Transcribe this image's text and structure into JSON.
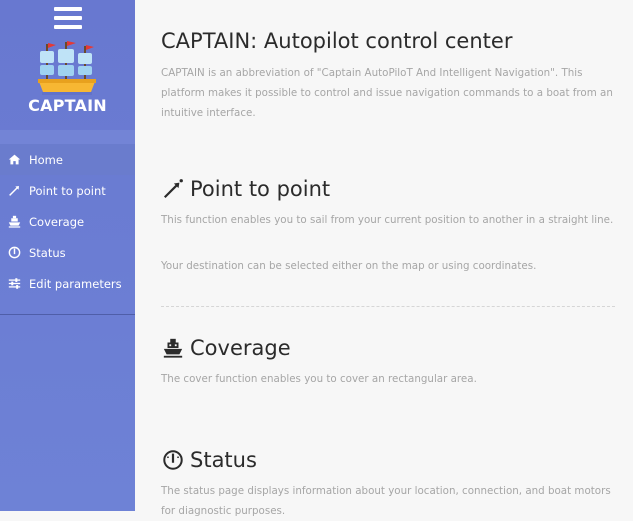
{
  "sidebar": {
    "brand": "CAPTAIN",
    "items": [
      {
        "label": "Home",
        "icon": "home-icon"
      },
      {
        "label": "Point to point",
        "icon": "arrow-icon"
      },
      {
        "label": "Coverage",
        "icon": "ship-icon"
      },
      {
        "label": "Status",
        "icon": "gauge-icon"
      },
      {
        "label": "Edit parameters",
        "icon": "sliders-icon"
      }
    ],
    "colors": {
      "background": "#6878d0",
      "active": "#6a7ccd"
    }
  },
  "main": {
    "title": "CAPTAIN: Autopilot control center",
    "intro": "CAPTAIN is an abbreviation of \"Captain AutoPiloT And Intelligent Navigation\". This platform makes it possible to control and issue navigation commands to a boat from an intuitive interface.",
    "sections": [
      {
        "title": "Point to point",
        "icon": "arrow-icon",
        "paragraphs": [
          "This function enables you to sail from your current position to another in a straight line.",
          "Your destination can be selected either on the map or using coordinates."
        ]
      },
      {
        "title": "Coverage",
        "icon": "ship-icon",
        "paragraphs": [
          "The cover function enables you to cover an rectangular area."
        ]
      },
      {
        "title": "Status",
        "icon": "gauge-icon",
        "paragraphs": [
          "The status page displays information about your location, connection, and boat motors for diagnostic purposes."
        ]
      }
    ]
  }
}
